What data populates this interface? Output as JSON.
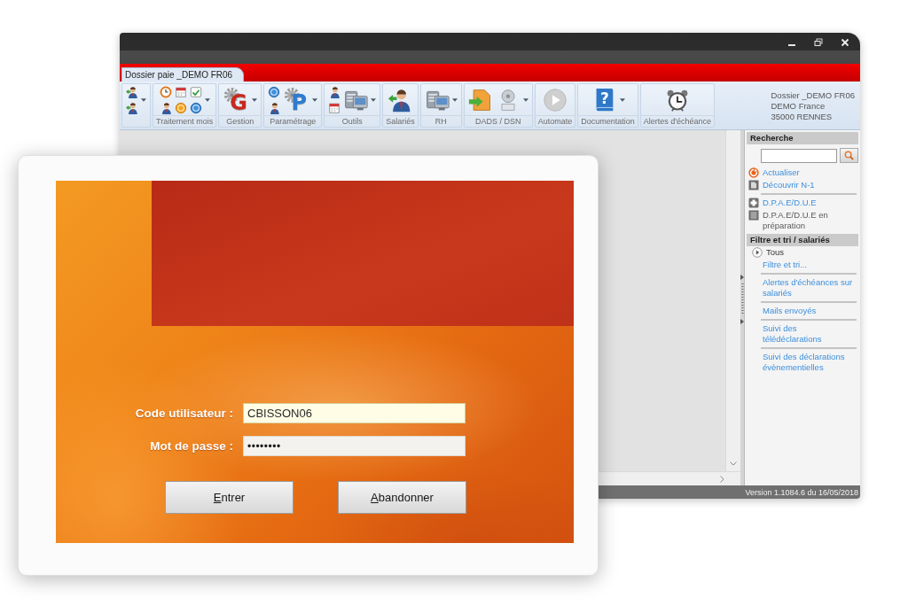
{
  "window": {
    "tabs": [
      {
        "label": "Dossier paie _DEMO FR06",
        "selected": true
      }
    ]
  },
  "ribbon": {
    "groups": [
      {
        "dropdown": true
      },
      {
        "label": "Traitement mois",
        "dropdown": true
      },
      {
        "label": "Gestion",
        "glyph": "G",
        "dropdown": true
      },
      {
        "label": "Paramétrage",
        "glyph": "P",
        "dropdown": true
      },
      {
        "label": "Outils",
        "dropdown": true
      },
      {
        "label": "Salariés",
        "dropdown": false
      },
      {
        "label": "RH",
        "dropdown": true
      },
      {
        "label": "DADS / DSN",
        "dropdown": true
      },
      {
        "label": "Automate",
        "dropdown": false
      },
      {
        "label": "Documentation",
        "glyph": "?",
        "dropdown": true
      },
      {
        "label": "Alertes d'échéance",
        "dropdown": false
      }
    ],
    "file_info": [
      "Dossier _DEMO FR06",
      "DEMO France",
      "35000 RENNES"
    ]
  },
  "sidebar": {
    "search": {
      "title": "Recherche"
    },
    "action_groups": [
      {
        "items": [
          {
            "label": "Actualiser",
            "kind": "link"
          },
          {
            "label": "Découvrir N-1",
            "kind": "link"
          }
        ]
      },
      {
        "items": [
          {
            "label": "D.P.A.E/D.U.E",
            "kind": "link"
          },
          {
            "label": "D.P.A.E/D.U.E en préparation",
            "kind": "text"
          }
        ]
      }
    ],
    "filter": {
      "title": "Filtre et tri / salariés",
      "items": [
        {
          "label": "Tous",
          "kind": "option"
        },
        {
          "label": "Filtre et tri...",
          "kind": "link"
        }
      ]
    },
    "links": [
      "Alertes d'échéances sur salariés",
      "Mails envoyés",
      "Suivi des télédéclarations",
      "Suivi des déclarations évènementielles"
    ]
  },
  "status_bar": {
    "version": "Version 1.1084.6 du 16/05/2018"
  },
  "login": {
    "fields": [
      {
        "label": "Code utilisateur :",
        "value": "CBISSON06",
        "kind": "text",
        "focused": true
      },
      {
        "label": "Mot de passe :",
        "value": "••••••••",
        "kind": "password",
        "focused": false
      }
    ],
    "buttons": [
      "Entrer",
      "Abandonner"
    ]
  }
}
